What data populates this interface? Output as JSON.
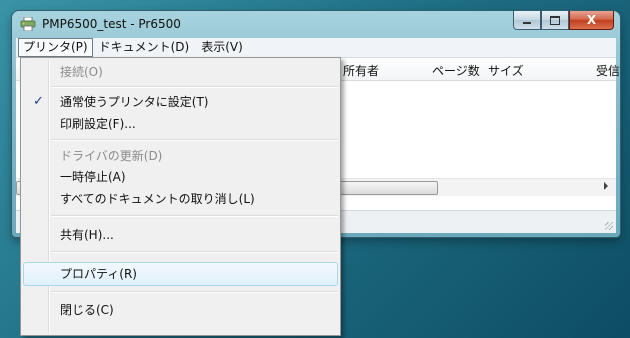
{
  "window": {
    "title": "PMP6500_test - Pr6500"
  },
  "menubar": {
    "items": [
      {
        "label": "プリンタ(P)"
      },
      {
        "label": "ドキュメント(D)"
      },
      {
        "label": "表示(V)"
      }
    ]
  },
  "columns": {
    "owner": "所有者",
    "pages": "ページ数",
    "size": "サイズ",
    "received": "受信"
  },
  "dropdown": {
    "items": [
      {
        "label": "接続(O)",
        "enabled": false
      },
      {
        "label": "通常使うプリンタに設定(T)",
        "checked": true
      },
      {
        "label": "印刷設定(F)..."
      },
      {
        "label": "ドライバの更新(D)",
        "enabled": false
      },
      {
        "label": "一時停止(A)"
      },
      {
        "label": "すべてのドキュメントの取り消し(L)"
      },
      {
        "label": "共有(H)..."
      },
      {
        "label": "プロパティ(R)",
        "highlighted": true
      },
      {
        "label": "閉じる(C)"
      }
    ],
    "check_mark": "✓"
  },
  "caption_buttons": {
    "close_glyph": "X"
  }
}
